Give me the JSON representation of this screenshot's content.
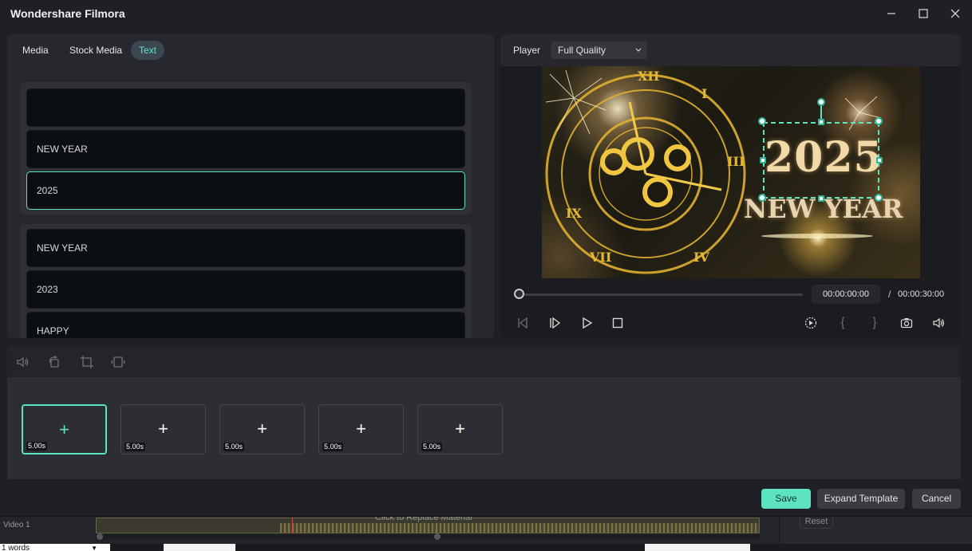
{
  "window": {
    "title": "Wondershare Filmora"
  },
  "tabs": [
    {
      "label": "Media"
    },
    {
      "label": "Stock Media"
    },
    {
      "label": "Text"
    }
  ],
  "text_groups": [
    {
      "fields": [
        "",
        "NEW YEAR",
        "2025"
      ]
    },
    {
      "fields": [
        "NEW YEAR",
        "2023",
        "HAPPY"
      ]
    }
  ],
  "player": {
    "label": "Player",
    "quality": "Full Quality",
    "current_time": "00:00:00:00",
    "separator": "/",
    "total_time": "00:00:30:00",
    "progress": 0
  },
  "preview": {
    "year_text": "2025",
    "sub_text": "NEW YEAR"
  },
  "clips": [
    {
      "duration": "5.00s",
      "selected": true
    },
    {
      "duration": "5.00s",
      "selected": false
    },
    {
      "duration": "5.00s",
      "selected": false
    },
    {
      "duration": "5.00s",
      "selected": false
    },
    {
      "duration": "5.00s",
      "selected": false
    }
  ],
  "buttons": {
    "save": "Save",
    "expand": "Expand Template",
    "cancel": "Cancel"
  },
  "background_app": {
    "track_label": "Video 1",
    "track_text": "Click to Replace Material",
    "reset_label": "Reset",
    "words_label": "1 words"
  },
  "colors": {
    "accent": "#5ee3c0",
    "dialog_bg": "#1e2025",
    "panel_bg": "#26282d"
  }
}
